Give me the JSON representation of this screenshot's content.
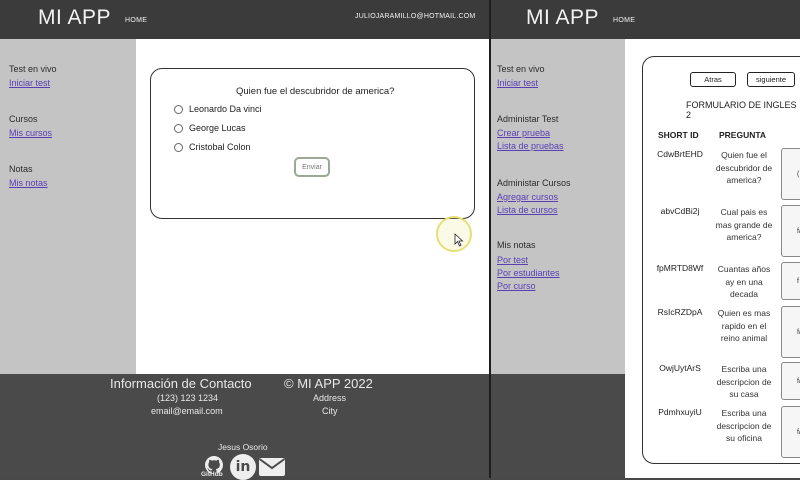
{
  "left": {
    "brand": "MI APP",
    "home_label": "HOME",
    "user_email": "JULIOJARAMILLO@HOTMAIL.COM",
    "sidebar": {
      "sections": [
        {
          "heading": "Test en vivo",
          "links": [
            "Iniciar test"
          ]
        },
        {
          "heading": "Cursos",
          "links": [
            "Mis cursos"
          ]
        },
        {
          "heading": "Notas",
          "links": [
            "Mis notas"
          ]
        }
      ]
    },
    "quiz": {
      "question": "Quien fue el descubridor de america?",
      "options": [
        "Leonardo Da vinci",
        "George Lucas",
        "Cristobal Colon"
      ],
      "submit_label": "Enviar"
    },
    "footer": {
      "contact_title": "Información de Contacto",
      "phone": "(123) 123 1234",
      "email": "email@email.com",
      "copyright": "© MI APP 2022",
      "address": "Address",
      "city": "City",
      "author": "Jesus Osorio",
      "github_label": "GitHub"
    }
  },
  "right": {
    "brand": "MI APP",
    "home_label": "HOME",
    "sidebar": {
      "sections": [
        {
          "heading": "Test en vivo",
          "links": [
            "Iniciar test"
          ]
        },
        {
          "heading": "Administar Test",
          "links": [
            "Crear prueba",
            "Lista de pruebas"
          ]
        },
        {
          "heading": "Administar Cursos",
          "links": [
            "Agregar cursos",
            "Lista de cursos"
          ]
        },
        {
          "heading": "Mis notas",
          "links": [
            "Por test",
            "Por estudiantes",
            "Por curso"
          ]
        }
      ]
    },
    "form": {
      "back_label": "Atras",
      "next_label": "siguiente",
      "title": "FORMULARIO DE INGLES 2",
      "columns": [
        "SHORT ID",
        "PREGUNTA"
      ],
      "rows": [
        {
          "id": "CdwBrtEHD",
          "question": "Quien fue el descubridor de america?",
          "extra": "("
        },
        {
          "id": "abvCdBi2j",
          "question": "Cual pais es mas grande de america?",
          "extra": "f/"
        },
        {
          "id": "fpMRTD8Wf",
          "question": "Cuantas años ay en una decada",
          "extra": "f"
        },
        {
          "id": "RsIcRZDpA",
          "question": "Quien es mas rapido en el reino animal",
          "extra": "f/"
        },
        {
          "id": "OwjUytArS",
          "question": "Escriba una descripcion de su casa",
          "extra": "f/"
        },
        {
          "id": "PdmhxuyiU",
          "question": "Escriba una descripcion de su oficina",
          "extra": "f/"
        }
      ]
    }
  }
}
